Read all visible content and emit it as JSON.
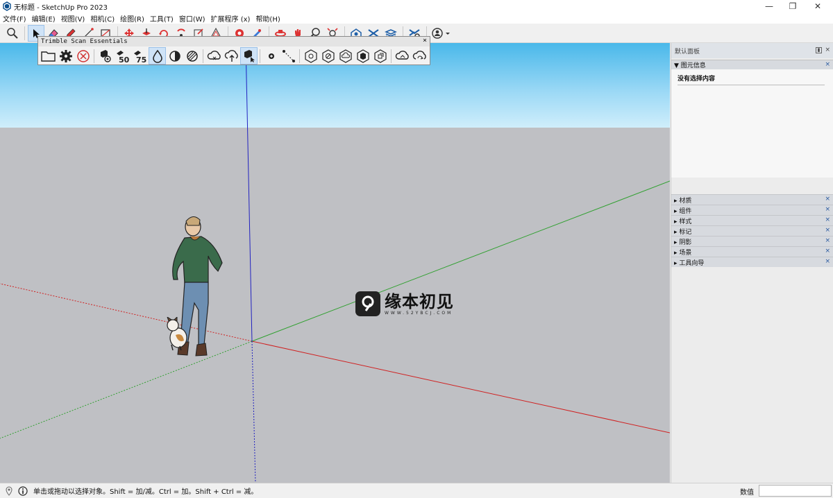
{
  "window": {
    "title": "无标题 - SketchUp Pro 2023",
    "minimize_glyph": "—",
    "restore_glyph": "❐",
    "close_glyph": "✕"
  },
  "menubar": {
    "items": [
      "文件(F)",
      "编辑(E)",
      "视图(V)",
      "相机(C)",
      "绘图(R)",
      "工具(T)",
      "窗口(W)",
      "扩展程序 (x)",
      "帮助(H)"
    ]
  },
  "toolbar": {
    "icons": [
      "search-icon",
      "select-arrow-icon",
      "eraser-icon",
      "pencil-icon",
      "line-icon",
      "rectangle-icon",
      "move-icon",
      "push-pull-icon",
      "rotate-icon",
      "follow-me-icon",
      "scale-icon",
      "offset-icon",
      "paint-bucket-icon",
      "tape-measure-icon",
      "orbit-icon",
      "pan-icon",
      "zoom-icon",
      "zoom-extents-icon",
      "warehouse-icon",
      "extension-warehouse-icon",
      "layout-icon",
      "extension-manager-icon",
      "profile-icon"
    ]
  },
  "scan_toolbar": {
    "title": "Trimble Scan Essentials",
    "close": "×",
    "badge_50": "50",
    "badge_75": "75"
  },
  "tray": {
    "title": "默认面板",
    "pin": "▮",
    "close": "×",
    "entity_info": {
      "label": "▼ 图元信息",
      "empty_text": "没有选择内容"
    },
    "panels": [
      "▸ 材质",
      "▸ 组件",
      "▸ 样式",
      "▸ 标记",
      "▸ 阴影",
      "▸ 场景",
      "▸ 工具向导"
    ]
  },
  "statusbar": {
    "message": "单击或拖动以选择对象。Shift = 加/减。Ctrl = 加。Shift + Ctrl = 减。",
    "measurements_label": "数值",
    "measurements_value": ""
  },
  "watermark": {
    "text": "缘本初见",
    "url": "WWW.52YBCJ.COM"
  },
  "colors": {
    "sky_top": "#49b8ea",
    "ground": "#bfc0c4",
    "axis_red": "#d02020",
    "axis_green": "#30a030",
    "axis_blue": "#2020c0"
  }
}
